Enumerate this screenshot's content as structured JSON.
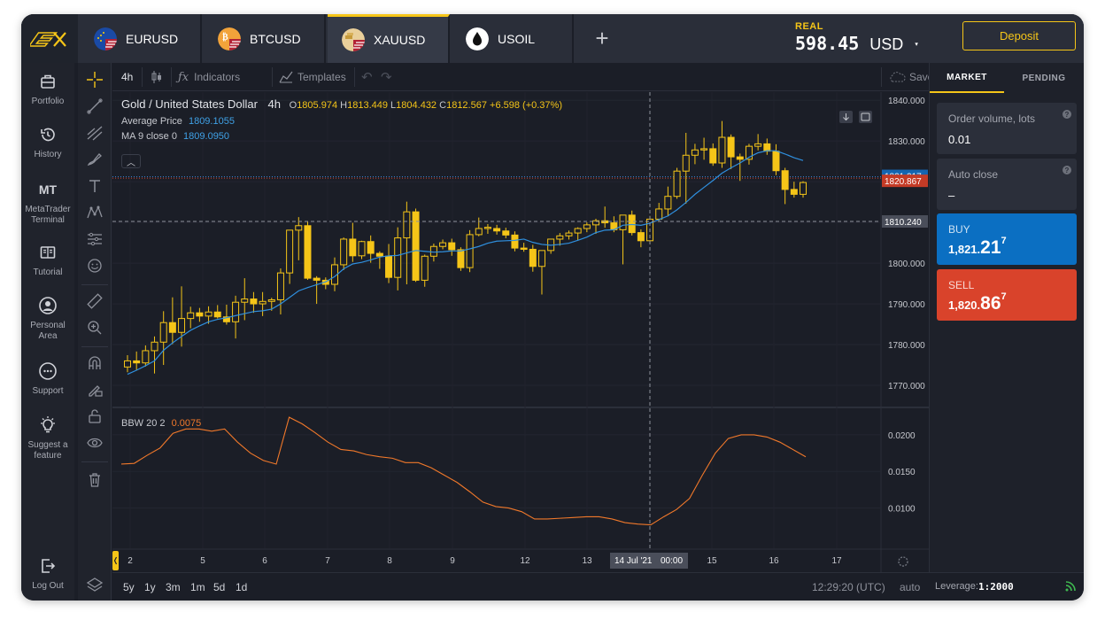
{
  "tabs": [
    {
      "symbol": "EURUSD",
      "icon": "eu-us-flag-icon",
      "active": false
    },
    {
      "symbol": "BTCUSD",
      "icon": "btc-us-flag-icon",
      "active": false
    },
    {
      "symbol": "XAUUSD",
      "icon": "gold-us-flag-icon",
      "active": true
    },
    {
      "symbol": "USOIL",
      "icon": "oil-drop-icon",
      "active": false
    }
  ],
  "add_tab_label": "+",
  "account": {
    "type": "REAL",
    "balance": "598.45",
    "currency": "USD",
    "deposit_label": "Deposit"
  },
  "nav": [
    {
      "label": "Portfolio",
      "icon": "briefcase-icon"
    },
    {
      "label": "History",
      "icon": "history-icon"
    },
    {
      "label": "MetaTrader Terminal",
      "icon": "mt-icon",
      "icon_text": "MT"
    },
    {
      "label": "Tutorial",
      "icon": "book-icon"
    },
    {
      "label": "Personal Area",
      "icon": "user-circle-icon"
    },
    {
      "label": "Support",
      "icon": "chat-icon"
    },
    {
      "label": "Suggest a feature",
      "icon": "lightbulb-icon"
    },
    {
      "label": "Log Out",
      "icon": "logout-icon"
    }
  ],
  "chart_toolbar": {
    "timeframe": "4h",
    "indicators_label": "Indicators",
    "templates_label": "Templates",
    "save_label": "Save"
  },
  "legend": {
    "title": "Gold / United States Dollar",
    "timeframe": "4h",
    "open_label": "O",
    "open": "1805.974",
    "high_label": "H",
    "high": "1813.449",
    "low_label": "L",
    "low": "1804.432",
    "close_label": "C",
    "close": "1812.567",
    "change": "+6.598 (+0.37%)",
    "avg_label": "Average Price",
    "avg_value": "1809.1055",
    "ma_label": "MA 9 close 0",
    "ma_value": "1809.0950",
    "bbw_label": "BBW 20 2",
    "bbw_value": "0.0075"
  },
  "price_axis": {
    "ticks": [
      "1840.000",
      "1830.000",
      "1820.000",
      "1810.000",
      "1800.000",
      "1790.000",
      "1780.000",
      "1770.000"
    ],
    "ask_tag": "1821.217",
    "bid_tag": "1820.867",
    "crosshair_tag": "1810.240"
  },
  "bbw_axis": {
    "ticks": [
      "0.0200",
      "0.0150",
      "0.0100"
    ]
  },
  "time_axis": {
    "ticks": [
      "2",
      "5",
      "6",
      "7",
      "8",
      "9",
      "12",
      "13",
      "15",
      "16",
      "17"
    ],
    "crosshair_date": "14 Jul '21",
    "crosshair_time": "00:00"
  },
  "ranges": [
    "5y",
    "1y",
    "3m",
    "1m",
    "5d",
    "1d"
  ],
  "bottom": {
    "clock": "12:29:20 (UTC)",
    "scale": "auto",
    "leverage_label": "Leverage:",
    "leverage_value": "1:2000"
  },
  "panel": {
    "tab_market": "MARKET",
    "tab_pending": "PENDING",
    "volume_label": "Order volume, lots",
    "volume_value": "0.01",
    "autoclose_label": "Auto close",
    "autoclose_value": "–",
    "help_glyph": "?",
    "buy_label": "BUY",
    "buy_prefix": "1,821.",
    "buy_big": "21",
    "buy_sup": "7",
    "sell_label": "SELL",
    "sell_prefix": "1,820.",
    "sell_big": "86",
    "sell_sup": "7"
  },
  "colors": {
    "accent": "#f5c518",
    "buy": "#0b6fc2",
    "sell": "#d9432b",
    "ma": "#2f8fde",
    "bbw": "#f0782a"
  },
  "chart_data": {
    "type": "candlestick",
    "price_range": [
      1765,
      1842
    ],
    "candles": [
      [
        1774.5,
        1777.4,
        1773.2,
        1776.0
      ],
      [
        1776.0,
        1778.3,
        1773.8,
        1775.5
      ],
      [
        1775.5,
        1779.8,
        1774.6,
        1778.5
      ],
      [
        1778.5,
        1782.0,
        1772.9,
        1780.6
      ],
      [
        1780.6,
        1788.2,
        1775.0,
        1785.4
      ],
      [
        1785.4,
        1791.6,
        1780.1,
        1783.0
      ],
      [
        1783.0,
        1794.3,
        1779.5,
        1786.4
      ],
      [
        1786.4,
        1789.3,
        1784.0,
        1787.8
      ],
      [
        1787.8,
        1789.0,
        1785.6,
        1787.0
      ],
      [
        1787.0,
        1789.4,
        1785.1,
        1788.0
      ],
      [
        1788.0,
        1789.7,
        1786.4,
        1786.8
      ],
      [
        1786.8,
        1789.8,
        1784.9,
        1785.6
      ],
      [
        1785.6,
        1792.0,
        1781.5,
        1790.4
      ],
      [
        1790.4,
        1796.3,
        1786.0,
        1791.2
      ],
      [
        1791.2,
        1792.9,
        1787.8,
        1790.0
      ],
      [
        1790.0,
        1792.9,
        1787.0,
        1790.6
      ],
      [
        1790.6,
        1791.5,
        1788.3,
        1791.0
      ],
      [
        1791.0,
        1798.7,
        1787.4,
        1797.6
      ],
      [
        1797.6,
        1807.2,
        1794.9,
        1808.1
      ],
      [
        1808.1,
        1811.3,
        1800.7,
        1809.2
      ],
      [
        1809.2,
        1810.2,
        1795.9,
        1796.3
      ],
      [
        1796.3,
        1796.8,
        1790.0,
        1795.8
      ],
      [
        1795.8,
        1796.5,
        1793.6,
        1794.8
      ],
      [
        1794.8,
        1801.4,
        1793.1,
        1799.6
      ],
      [
        1799.6,
        1806.3,
        1798.3,
        1805.9
      ],
      [
        1805.9,
        1809.9,
        1800.3,
        1801.8
      ],
      [
        1801.8,
        1805.5,
        1801.0,
        1805.3
      ],
      [
        1805.3,
        1806.8,
        1800.1,
        1802.4
      ],
      [
        1802.4,
        1802.9,
        1798.6,
        1801.7
      ],
      [
        1801.7,
        1804.7,
        1795.1,
        1796.5
      ],
      [
        1796.5,
        1808.8,
        1793.3,
        1806.2
      ],
      [
        1806.2,
        1815.1,
        1794.8,
        1812.6
      ],
      [
        1812.6,
        1813.4,
        1795.4,
        1795.8
      ],
      [
        1795.8,
        1802.1,
        1794.2,
        1801.7
      ],
      [
        1801.7,
        1804.8,
        1800.4,
        1804.1
      ],
      [
        1804.1,
        1805.8,
        1803.4,
        1805.0
      ],
      [
        1805.0,
        1806.0,
        1801.8,
        1803.3
      ],
      [
        1803.3,
        1803.9,
        1798.1,
        1798.9
      ],
      [
        1798.9,
        1808.1,
        1797.8,
        1807.0
      ],
      [
        1807.0,
        1811.2,
        1806.6,
        1808.5
      ],
      [
        1808.5,
        1809.6,
        1807.2,
        1808.8
      ],
      [
        1808.5,
        1809.4,
        1807.0,
        1807.9
      ],
      [
        1807.9,
        1808.7,
        1806.1,
        1806.9
      ],
      [
        1806.9,
        1807.8,
        1802.9,
        1803.7
      ],
      [
        1803.7,
        1805.0,
        1802.8,
        1803.4
      ],
      [
        1803.4,
        1804.5,
        1797.9,
        1799.2
      ],
      [
        1799.2,
        1802.7,
        1792.3,
        1803.1
      ],
      [
        1803.1,
        1804.2,
        1802.3,
        1805.9
      ],
      [
        1805.9,
        1807.4,
        1804.3,
        1806.7
      ],
      [
        1806.7,
        1808.0,
        1805.8,
        1807.4
      ],
      [
        1807.4,
        1808.8,
        1805.6,
        1808.5
      ],
      [
        1808.5,
        1810.0,
        1807.6,
        1809.4
      ],
      [
        1809.4,
        1810.9,
        1807.2,
        1810.4
      ],
      [
        1810.4,
        1813.9,
        1808.7,
        1809.9
      ],
      [
        1809.9,
        1811.5,
        1807.6,
        1808.2
      ],
      [
        1808.2,
        1811.3,
        1799.7,
        1811.8
      ],
      [
        1811.8,
        1812.9,
        1806.8,
        1807.5
      ],
      [
        1807.5,
        1808.3,
        1803.9,
        1805.5
      ],
      [
        1805.5,
        1811.6,
        1804.6,
        1810.8
      ],
      [
        1810.8,
        1814.8,
        1810.4,
        1813.3
      ],
      [
        1813.3,
        1818.8,
        1811.5,
        1816.4
      ],
      [
        1816.4,
        1823.4,
        1815.8,
        1822.6
      ],
      [
        1822.6,
        1832.0,
        1814.6,
        1826.5
      ],
      [
        1826.5,
        1829.3,
        1824.3,
        1827.8
      ],
      [
        1827.8,
        1830.8,
        1825.4,
        1828.1
      ],
      [
        1828.1,
        1829.4,
        1823.9,
        1824.6
      ],
      [
        1824.6,
        1834.9,
        1823.4,
        1830.9
      ],
      [
        1830.9,
        1831.6,
        1823.1,
        1826.1
      ],
      [
        1826.1,
        1826.9,
        1820.2,
        1825.5
      ],
      [
        1825.5,
        1829.3,
        1824.2,
        1828.7
      ],
      [
        1828.7,
        1831.7,
        1827.7,
        1829.3
      ],
      [
        1829.3,
        1830.6,
        1826.6,
        1827.5
      ],
      [
        1827.5,
        1829.2,
        1821.6,
        1822.7
      ],
      [
        1822.7,
        1823.4,
        1814.5,
        1818.1
      ],
      [
        1818.1,
        1820.0,
        1816.1,
        1816.9
      ],
      [
        1816.9,
        1820.1,
        1816.1,
        1819.8
      ]
    ],
    "ma": [
      1772.7,
      1773.7,
      1774.8,
      1776.0,
      1778.6,
      1780.4,
      1782.0,
      1783.5,
      1784.6,
      1785.6,
      1786.2,
      1786.6,
      1787.1,
      1787.6,
      1788.1,
      1788.3,
      1788.7,
      1790.0,
      1791.6,
      1793.2,
      1794.0,
      1794.7,
      1795.4,
      1796.7,
      1798.6,
      1799.8,
      1800.2,
      1800.8,
      1801.5,
      1801.8,
      1801.9,
      1802.5,
      1803.1,
      1802.9,
      1802.7,
      1802.8,
      1803.0,
      1803.0,
      1803.5,
      1804.1,
      1804.9,
      1805.4,
      1805.5,
      1805.6,
      1805.9,
      1805.1,
      1804.6,
      1804.4,
      1804.6,
      1804.9,
      1805.6,
      1806.4,
      1807.5,
      1808.1,
      1808.2,
      1809.3,
      1809.5,
      1809.3,
      1809.8,
      1810.7,
      1811.6,
      1813.1,
      1814.9,
      1816.9,
      1818.6,
      1820.3,
      1822.1,
      1823.4,
      1824.6,
      1826.0,
      1827.1,
      1827.6,
      1827.6,
      1826.8,
      1825.9,
      1825.2
    ],
    "bbw_range": [
      0.0045,
      0.0235
    ],
    "bbw": [
      0.016,
      0.0161,
      0.0172,
      0.0182,
      0.0202,
      0.0208,
      0.0208,
      0.0205,
      0.0208,
      0.019,
      0.0175,
      0.0165,
      0.016,
      0.0224,
      0.0215,
      0.0203,
      0.019,
      0.018,
      0.0178,
      0.0173,
      0.017,
      0.0168,
      0.0162,
      0.0162,
      0.0155,
      0.0145,
      0.0135,
      0.0122,
      0.0108,
      0.0102,
      0.01,
      0.0095,
      0.0085,
      0.0085,
      0.0086,
      0.0087,
      0.0088,
      0.0088,
      0.0085,
      0.008,
      0.0078,
      0.0077,
      0.0088,
      0.0098,
      0.0113,
      0.0145,
      0.0175,
      0.0195,
      0.02,
      0.02,
      0.0197,
      0.019,
      0.018,
      0.017
    ]
  }
}
